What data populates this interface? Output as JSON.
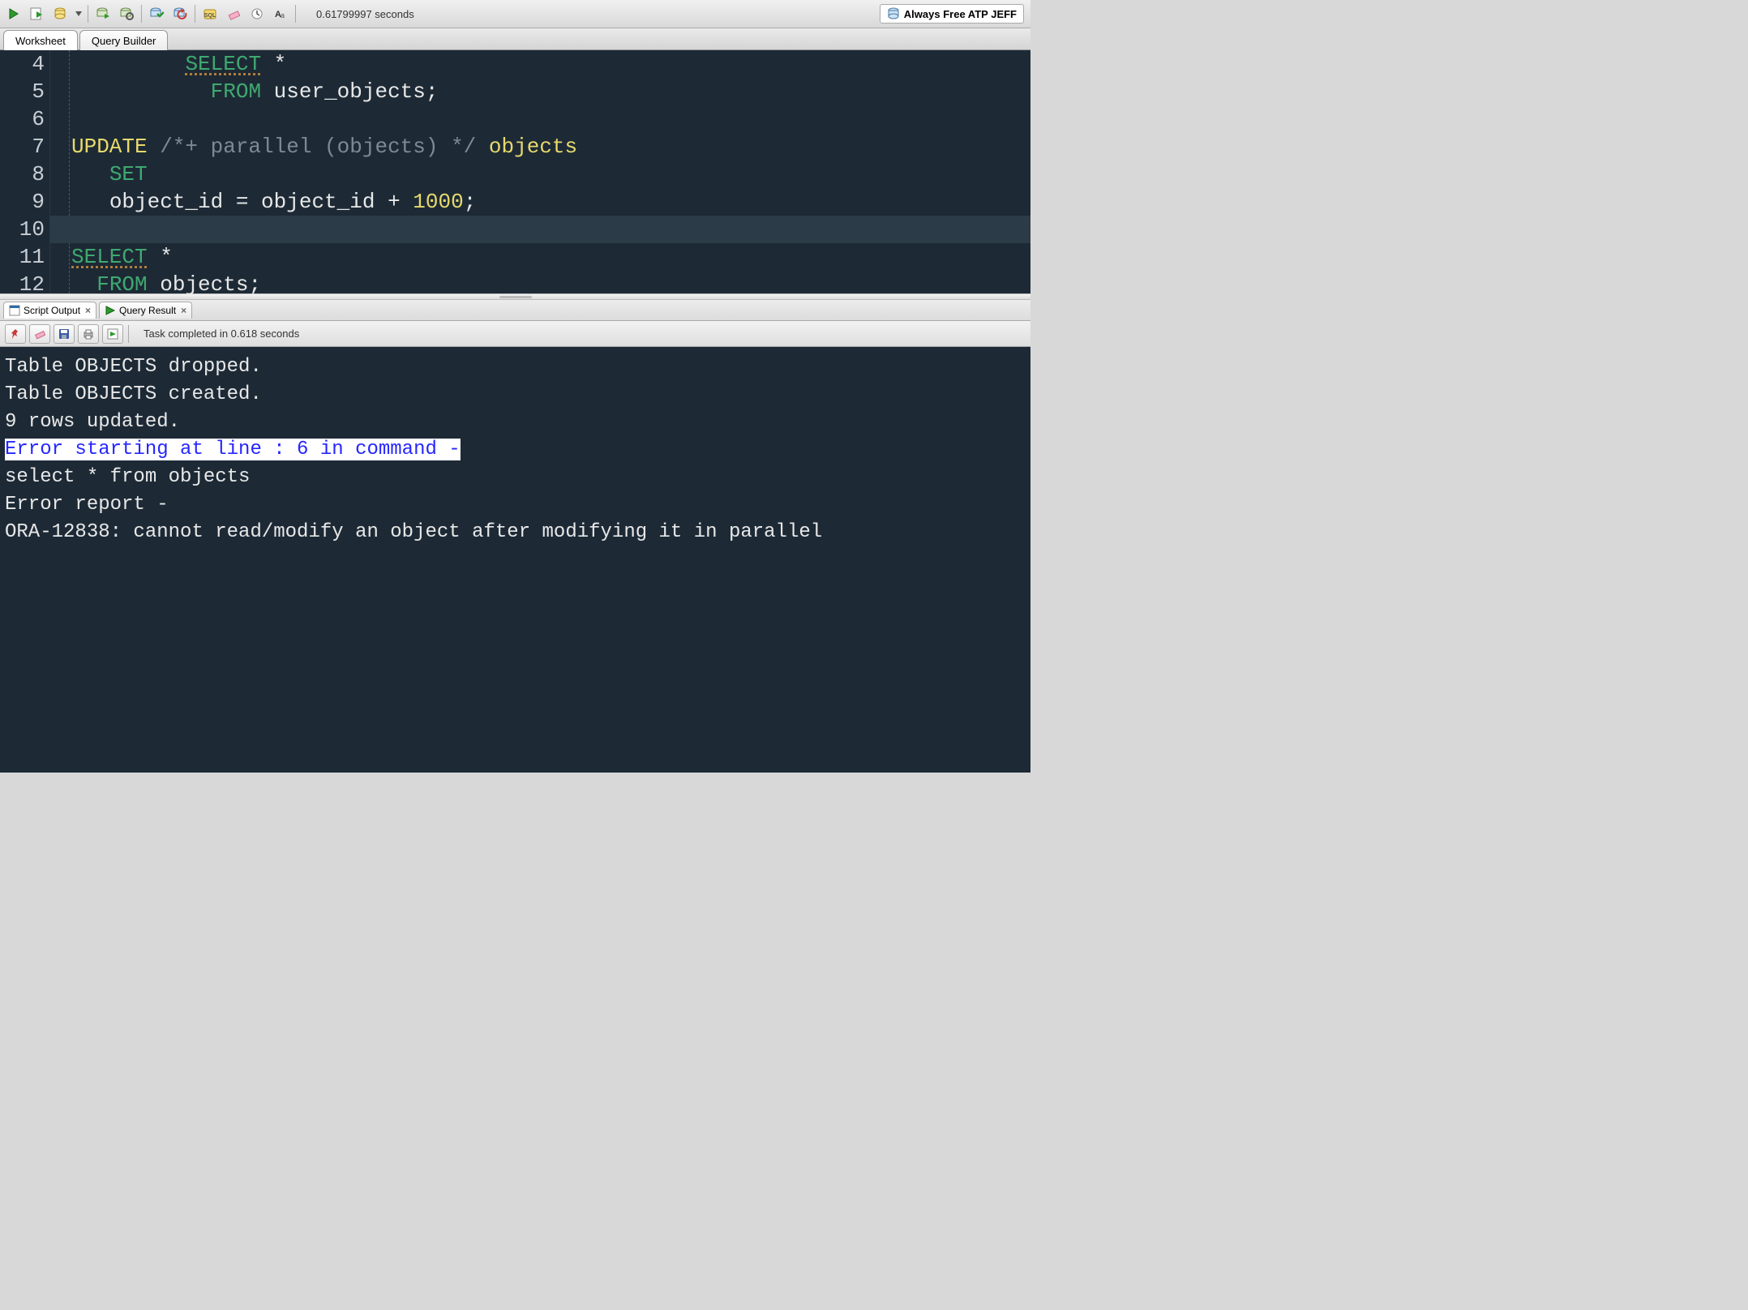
{
  "toolbar": {
    "status_text": "0.61799997 seconds",
    "connection_label": "Always Free ATP JEFF"
  },
  "tabs": {
    "worksheet": "Worksheet",
    "query_builder": "Query Builder"
  },
  "editor": {
    "lines": [
      {
        "n": "4",
        "indent": "         ",
        "tokens": [
          [
            "kw-green ul-dash",
            "SELECT"
          ],
          [
            "ident",
            " *"
          ]
        ]
      },
      {
        "n": "5",
        "indent": "         ",
        "tokens": [
          [
            "kw-green",
            "  FROM "
          ],
          [
            "ident",
            "user_objects"
          ],
          [
            "ident",
            ";"
          ]
        ]
      },
      {
        "n": "6",
        "indent": "",
        "tokens": []
      },
      {
        "n": "7",
        "indent": "",
        "tokens": [
          [
            "kw-yellow",
            "UPDATE "
          ],
          [
            "comment",
            "/*+ parallel (objects) */"
          ],
          [
            "ident",
            " "
          ],
          [
            "kw-yellow",
            "objects"
          ]
        ]
      },
      {
        "n": "8",
        "indent": "   ",
        "tokens": [
          [
            "kw-green",
            "SET"
          ]
        ]
      },
      {
        "n": "9",
        "indent": "   ",
        "tokens": [
          [
            "ident",
            "object_id = object_id + "
          ],
          [
            "num",
            "1000"
          ],
          [
            "ident",
            ";"
          ]
        ]
      },
      {
        "n": "10",
        "indent": "",
        "tokens": []
      },
      {
        "n": "11",
        "indent": "",
        "tokens": [
          [
            "kw-green ul-dash",
            "SELECT"
          ],
          [
            "ident",
            " *"
          ]
        ]
      },
      {
        "n": "12",
        "indent": "  ",
        "tokens": [
          [
            "kw-green",
            "FROM "
          ],
          [
            "ident",
            "objects"
          ],
          [
            "ident",
            ";"
          ]
        ]
      }
    ],
    "highlight_row_index": 6
  },
  "result_tabs": {
    "script_output": "Script Output",
    "query_result": "Query Result"
  },
  "result_toolbar": {
    "status_text": "Task completed in 0.618 seconds"
  },
  "console": {
    "line1": "",
    "line2": "Table OBJECTS dropped.",
    "line3": "",
    "line4": "",
    "line5": "Table OBJECTS created.",
    "line6": "",
    "line7": "",
    "line8": "9 rows updated.",
    "line9": "",
    "line10": "",
    "err_hl": "Error starting at line : 6 in command -",
    "line12": "select * from objects",
    "line13": "Error report -",
    "line14": "ORA-12838: cannot read/modify an object after modifying it in parallel"
  }
}
